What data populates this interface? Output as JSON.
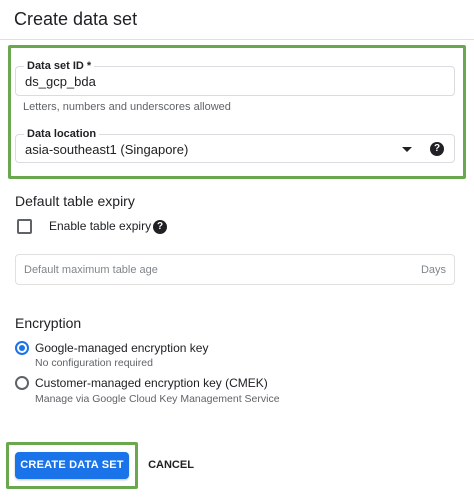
{
  "header": {
    "title": "Create data set"
  },
  "dataset_id": {
    "label": "Data set ID *",
    "value": "ds_gcp_bda",
    "helper": "Letters, numbers and underscores allowed"
  },
  "data_location": {
    "label": "Data location",
    "value": "asia-southeast1 (Singapore)"
  },
  "table_expiry": {
    "title": "Default table expiry",
    "checkbox_label": "Enable table expiry",
    "checked": false,
    "age_placeholder": "Default maximum table age",
    "age_suffix": "Days"
  },
  "encryption": {
    "title": "Encryption",
    "options": [
      {
        "label": "Google-managed encryption key",
        "sublabel": "No configuration required",
        "selected": true
      },
      {
        "label": "Customer-managed encryption key (CMEK)",
        "sublabel": "Manage via Google Cloud Key Management Service",
        "selected": false
      }
    ]
  },
  "actions": {
    "create_label": "CREATE DATA SET",
    "cancel_label": "CANCEL"
  },
  "colors": {
    "primary": "#1a73e8",
    "highlight": "#6aa84f"
  },
  "icons": {
    "help": "help-circle-icon",
    "dropdown": "dropdown-arrow-icon"
  }
}
